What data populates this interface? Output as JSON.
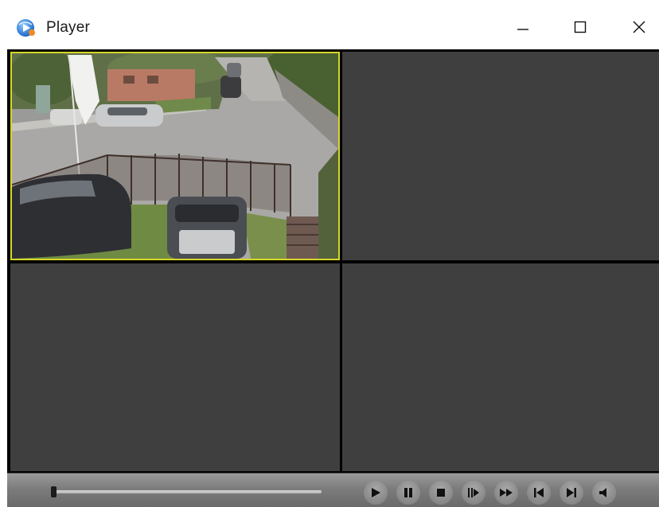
{
  "window": {
    "title": "Player",
    "app_icon": "player-app-icon",
    "controls": [
      "minimize-icon",
      "maximize-icon",
      "close-icon"
    ]
  },
  "grid": {
    "layout": "2x2",
    "panes": [
      {
        "id": 1,
        "state": "playing",
        "selected": true,
        "content": "camera-feed-image"
      },
      {
        "id": 2,
        "state": "empty"
      },
      {
        "id": 3,
        "state": "empty"
      },
      {
        "id": 4,
        "state": "empty"
      }
    ],
    "selected_border_color": "#d6d62a",
    "empty_pane_color": "#3f3f3f"
  },
  "playback": {
    "progress": 0.0,
    "buttons": [
      "play-icon",
      "pause-icon",
      "stop-icon",
      "step-forward-icon",
      "fast-forward-icon",
      "previous-icon",
      "next-icon",
      "volume-icon"
    ]
  }
}
